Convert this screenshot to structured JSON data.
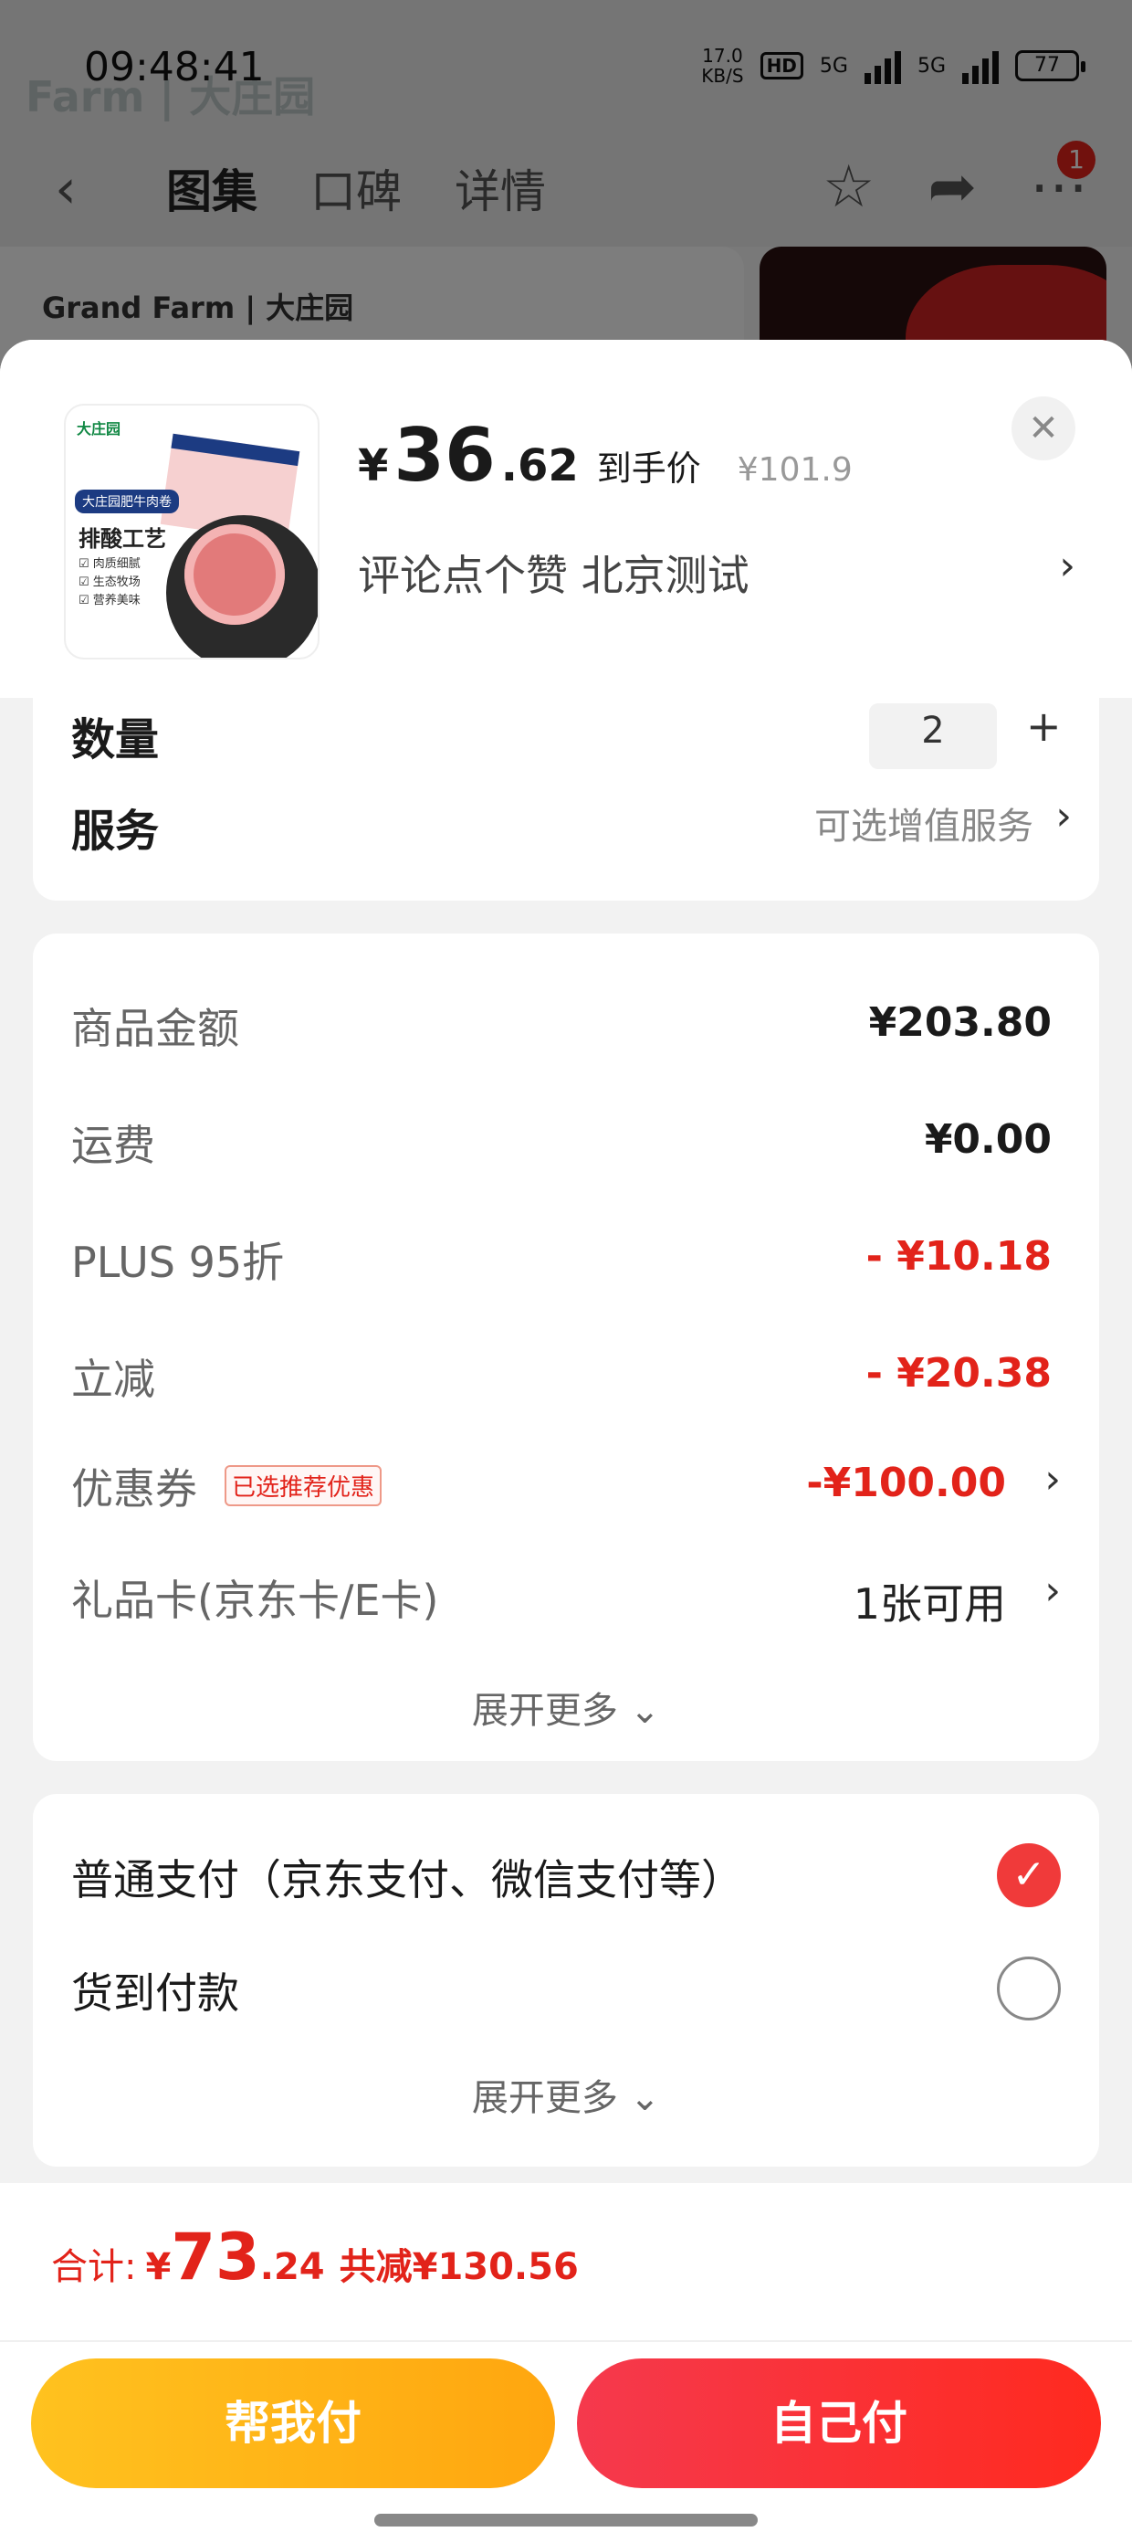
{
  "status_bar": {
    "time": "09:48:41",
    "net_speed_value": "17.0",
    "net_speed_unit": "KB/S",
    "hd": "HD",
    "sig1": "5G",
    "sig2": "5G",
    "battery": "77"
  },
  "background": {
    "brand_faint": "Farm | 大庄园",
    "tabs": [
      "图集",
      "口碑",
      "详情"
    ],
    "cart_badge": "1",
    "card_logo": "Grand Farm | 大庄园"
  },
  "product": {
    "image_brand": "大庄园",
    "image_tag": "大庄园肥牛肉卷",
    "image_title": "排酸工艺",
    "image_lines": [
      "☑ 肉质细腻",
      "☑ 生态牧场",
      "☑ 营养美味"
    ],
    "price_symbol": "¥",
    "price_int": "36",
    "price_dec": ".62",
    "price_tag": "到手价",
    "original_price": "¥101.9",
    "spec": "评论点个赞  北京测试"
  },
  "service_card": {
    "quantity_label": "数量",
    "quantity_value": "2",
    "service_label": "服务",
    "service_value": "可选增值服务"
  },
  "fees": [
    {
      "label": "商品金额",
      "value": "¥203.80",
      "style": "normal"
    },
    {
      "label": "运费",
      "value": "¥0.00",
      "style": "normal"
    },
    {
      "label": "PLUS 95折",
      "value": "- ¥10.18",
      "style": "red"
    },
    {
      "label": "立减",
      "value": "- ¥20.38",
      "style": "red"
    },
    {
      "label": "优惠券",
      "badge": "已选推荐优惠",
      "value": "-¥100.00",
      "style": "red"
    },
    {
      "label": "礼品卡(京东卡/E卡)",
      "value": "1张可用",
      "style": "plain"
    }
  ],
  "expand_more": "展开更多 ⌄",
  "payment": {
    "options": [
      {
        "label": "普通支付（京东支付、微信支付等）",
        "selected": true
      },
      {
        "label": "货到付款",
        "selected": false
      }
    ],
    "expand_more": "展开更多 ⌄"
  },
  "footer": {
    "total_label": "合计:",
    "total_symbol": "¥",
    "total_int": "73",
    "total_dec": ".24",
    "saved": "共减¥130.56",
    "help_pay": "帮我付",
    "self_pay": "自己付"
  },
  "colors": {
    "accent_red": "#e2231a",
    "help_button": "#ffb318",
    "self_button": "#f5394d"
  }
}
